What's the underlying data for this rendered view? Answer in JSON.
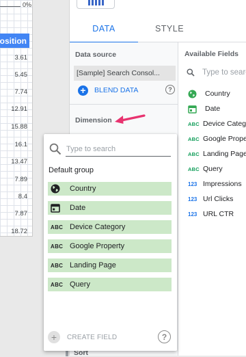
{
  "table": {
    "axis_label": "0%",
    "column_header": "Position",
    "values": [
      "3.61",
      "5.45",
      "7.74",
      "12.91",
      "15.88",
      "16.1",
      "13.47",
      "7.89",
      "8.4",
      "7.87",
      "18.72"
    ]
  },
  "panel": {
    "tabs": [
      {
        "label": "DATA",
        "active": true
      },
      {
        "label": "STYLE",
        "active": false
      }
    ],
    "data_source": {
      "title": "Data source",
      "value": "[Sample] Search Consol...",
      "blend_label": "BLEND DATA"
    },
    "dimension_title": "Dimension",
    "sort_label": "Sort",
    "available_fields": {
      "title": "Available Fields",
      "search_placeholder": "Type to search",
      "fields": [
        {
          "label": "Country",
          "type": "geo"
        },
        {
          "label": "Date",
          "type": "date"
        },
        {
          "label": "Device Category",
          "type": "text"
        },
        {
          "label": "Google Property",
          "type": "text"
        },
        {
          "label": "Landing Page",
          "type": "text"
        },
        {
          "label": "Query",
          "type": "text"
        },
        {
          "label": "Impressions",
          "type": "number"
        },
        {
          "label": "Url Clicks",
          "type": "number"
        },
        {
          "label": "URL CTR",
          "type": "number"
        }
      ]
    }
  },
  "dropdown": {
    "search_placeholder": "Type to search",
    "group_label": "Default group",
    "items": [
      {
        "label": "Country",
        "type": "geo"
      },
      {
        "label": "Date",
        "type": "date"
      },
      {
        "label": "Device Category",
        "type": "text"
      },
      {
        "label": "Google Property",
        "type": "text"
      },
      {
        "label": "Landing Page",
        "type": "text"
      },
      {
        "label": "Query",
        "type": "text"
      }
    ],
    "create_field_label": "CREATE FIELD"
  },
  "colors": {
    "accent": "#1a73e8",
    "header_blue": "#4285f4",
    "dimension_green": "#0f9d58",
    "item_highlight": "#cce8c8",
    "arrow": "#e8336f"
  },
  "icons": {
    "type_text": "ABC",
    "type_number": "123",
    "help": "?"
  }
}
